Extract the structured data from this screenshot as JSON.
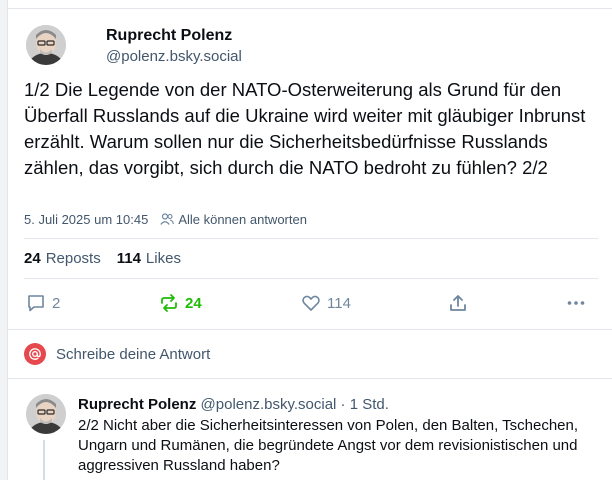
{
  "post": {
    "author_name": "Ruprecht Polenz",
    "author_handle": "@polenz.bsky.social",
    "text": "1/2 Die Legende von der NATO-Osterweiterung als Grund für den Überfall Russlands auf die Ukraine wird weiter mit gläubiger Inbrunst erzählt. Warum sollen nur die Sicherheitsbedürfnisse Russlands zählen, das vorgibt, sich durch die NATO bedroht zu fühlen? 2/2",
    "timestamp": "5. Juli 2025 um 10:45",
    "reply_permission": "Alle können antworten",
    "reposts_count": "24",
    "reposts_label": "Reposts",
    "likes_count": "114",
    "likes_label": "Likes"
  },
  "actions": {
    "reply_count": "2",
    "repost_count": "24",
    "like_count": "114",
    "share_icon": "share-icon",
    "more_icon": "more-icon"
  },
  "reply_box": {
    "placeholder": "Schreibe deine Antwort"
  },
  "reply": {
    "author_name": "Ruprecht Polenz",
    "author_handle": "@polenz.bsky.social",
    "time": "· 1 Std.",
    "text": "2/2 Nicht aber die Sicherheitsinteressen von Polen, den Balten, Tschechen, Ungarn und Rumänen, die begründete Angst vor dem revisionistischen und aggressiven Russland haben?"
  },
  "colors": {
    "accent_repost": "#20bc07",
    "muted": "#42576c",
    "mention_badge": "#e5484d"
  }
}
